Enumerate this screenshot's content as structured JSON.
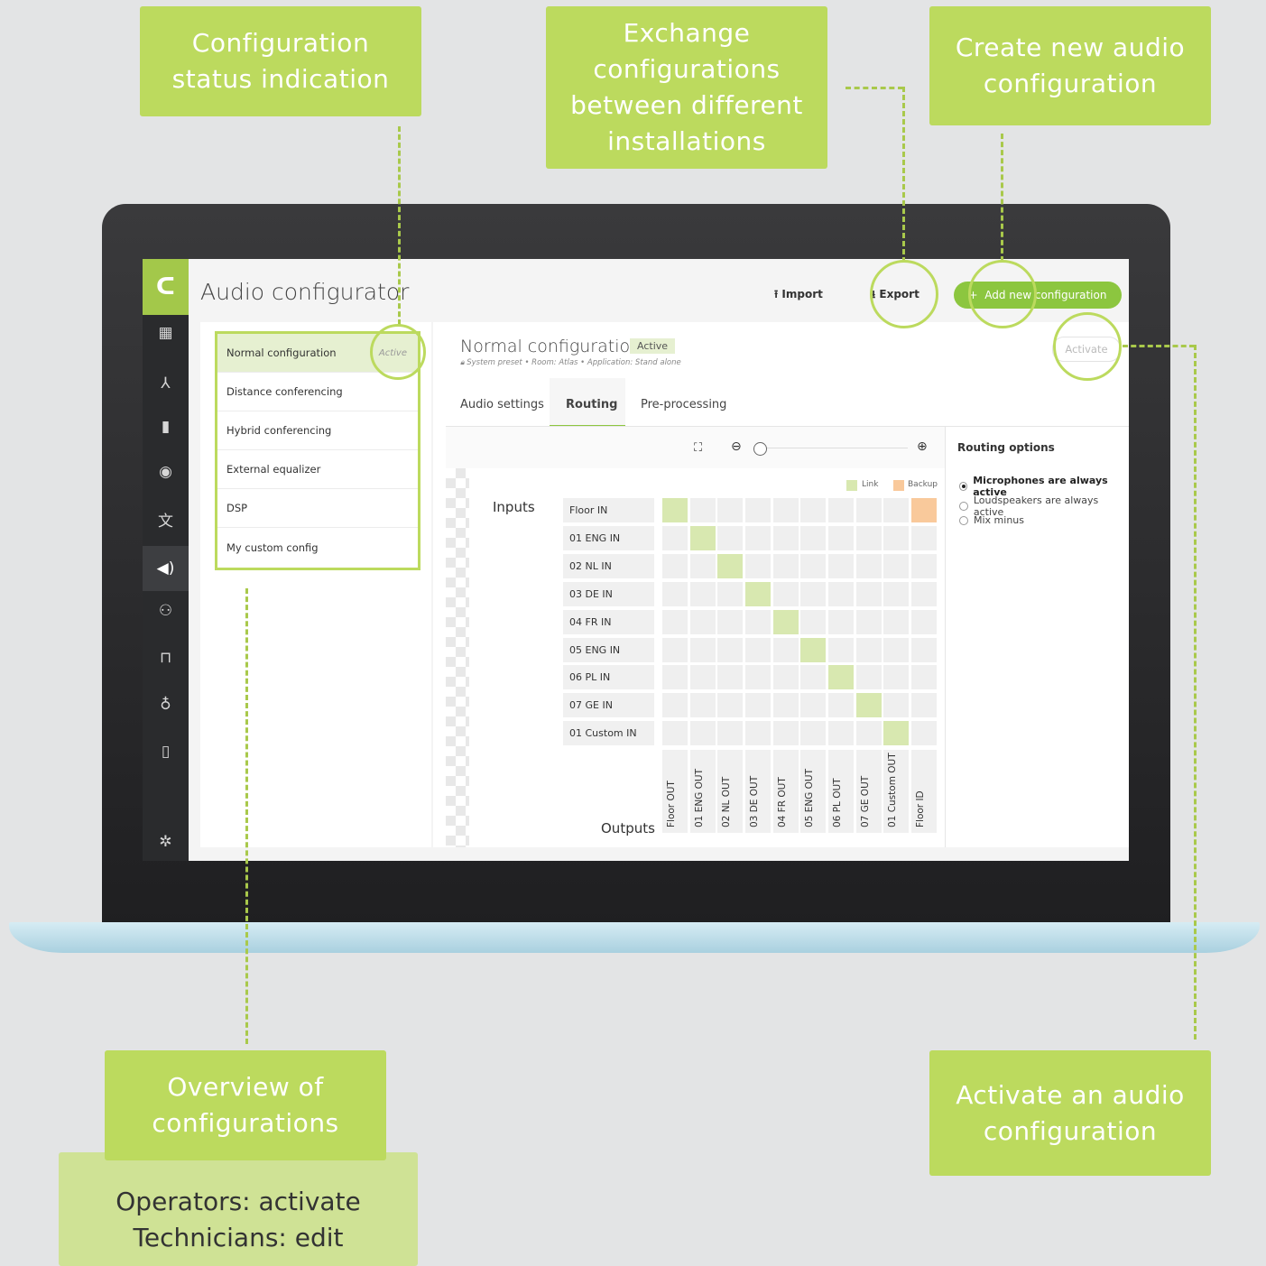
{
  "callouts": {
    "status": "Configuration status indication",
    "exchange": "Exchange configurations between different installations",
    "create": "Create new audio configuration",
    "overview": "Overview of configurations",
    "activate": "Activate an audio configuration",
    "roles_line1": "Operators: activate",
    "roles_line2": "Technicians: edit"
  },
  "app": {
    "logo": "ᑕ",
    "title": "Audio configurator",
    "import_label": "Import",
    "export_label": "Export",
    "add_label": "Add new configuration"
  },
  "nav_icons": [
    "dashboard-icon",
    "network-icon",
    "battery-icon",
    "speaker-person-icon",
    "translate-icon",
    "audio-icon",
    "participants-icon",
    "seat-icon",
    "microphone-icon",
    "document-icon",
    "settings-icon"
  ],
  "configurations": [
    {
      "name": "Normal configuration",
      "status": "Active"
    },
    {
      "name": "Distance conferencing",
      "status": ""
    },
    {
      "name": "Hybrid conferencing",
      "status": ""
    },
    {
      "name": "External equalizer",
      "status": ""
    },
    {
      "name": "DSP",
      "status": ""
    },
    {
      "name": "My custom config",
      "status": ""
    }
  ],
  "detail": {
    "title": "Normal configuration",
    "badge": "Active",
    "meta": "System preset  •  Room: Atlas  •  Application: Stand alone",
    "activate_label": "Activate",
    "tabs": [
      "Audio settings",
      "Routing",
      "Pre-processing"
    ],
    "selected_tab": "Routing"
  },
  "routing": {
    "inputs_label": "Inputs",
    "outputs_label": "Outputs",
    "legend_link": "Link",
    "legend_backup": "Backup",
    "inputs": [
      "Floor IN",
      "01 ENG IN",
      "02 NL IN",
      "03 DE IN",
      "04 FR IN",
      "05 ENG IN",
      "06 PL IN",
      "07 GE IN",
      "01 Custom IN"
    ],
    "outputs": [
      "Floor OUT",
      "01 ENG OUT",
      "02 NL OUT",
      "03 DE OUT",
      "04 FR OUT",
      "05 ENG OUT",
      "06 PL OUT",
      "07 GE OUT",
      "01 Custom OUT",
      "Floor ID"
    ],
    "links": [
      [
        0,
        0
      ],
      [
        1,
        1
      ],
      [
        2,
        2
      ],
      [
        3,
        3
      ],
      [
        4,
        4
      ],
      [
        5,
        5
      ],
      [
        6,
        6
      ],
      [
        7,
        7
      ],
      [
        8,
        8
      ]
    ],
    "backups": [
      [
        0,
        9
      ]
    ],
    "colors": {
      "link": "#d8e8b0",
      "backup": "#f9c99b"
    }
  },
  "routing_options": {
    "title": "Routing options",
    "options": [
      "Microphones are always active",
      "Loudspeakers are always active",
      "Mix minus"
    ],
    "selected": 0
  },
  "colors": {
    "accent": "#bcda5e",
    "brand_green": "#8cc63f"
  }
}
